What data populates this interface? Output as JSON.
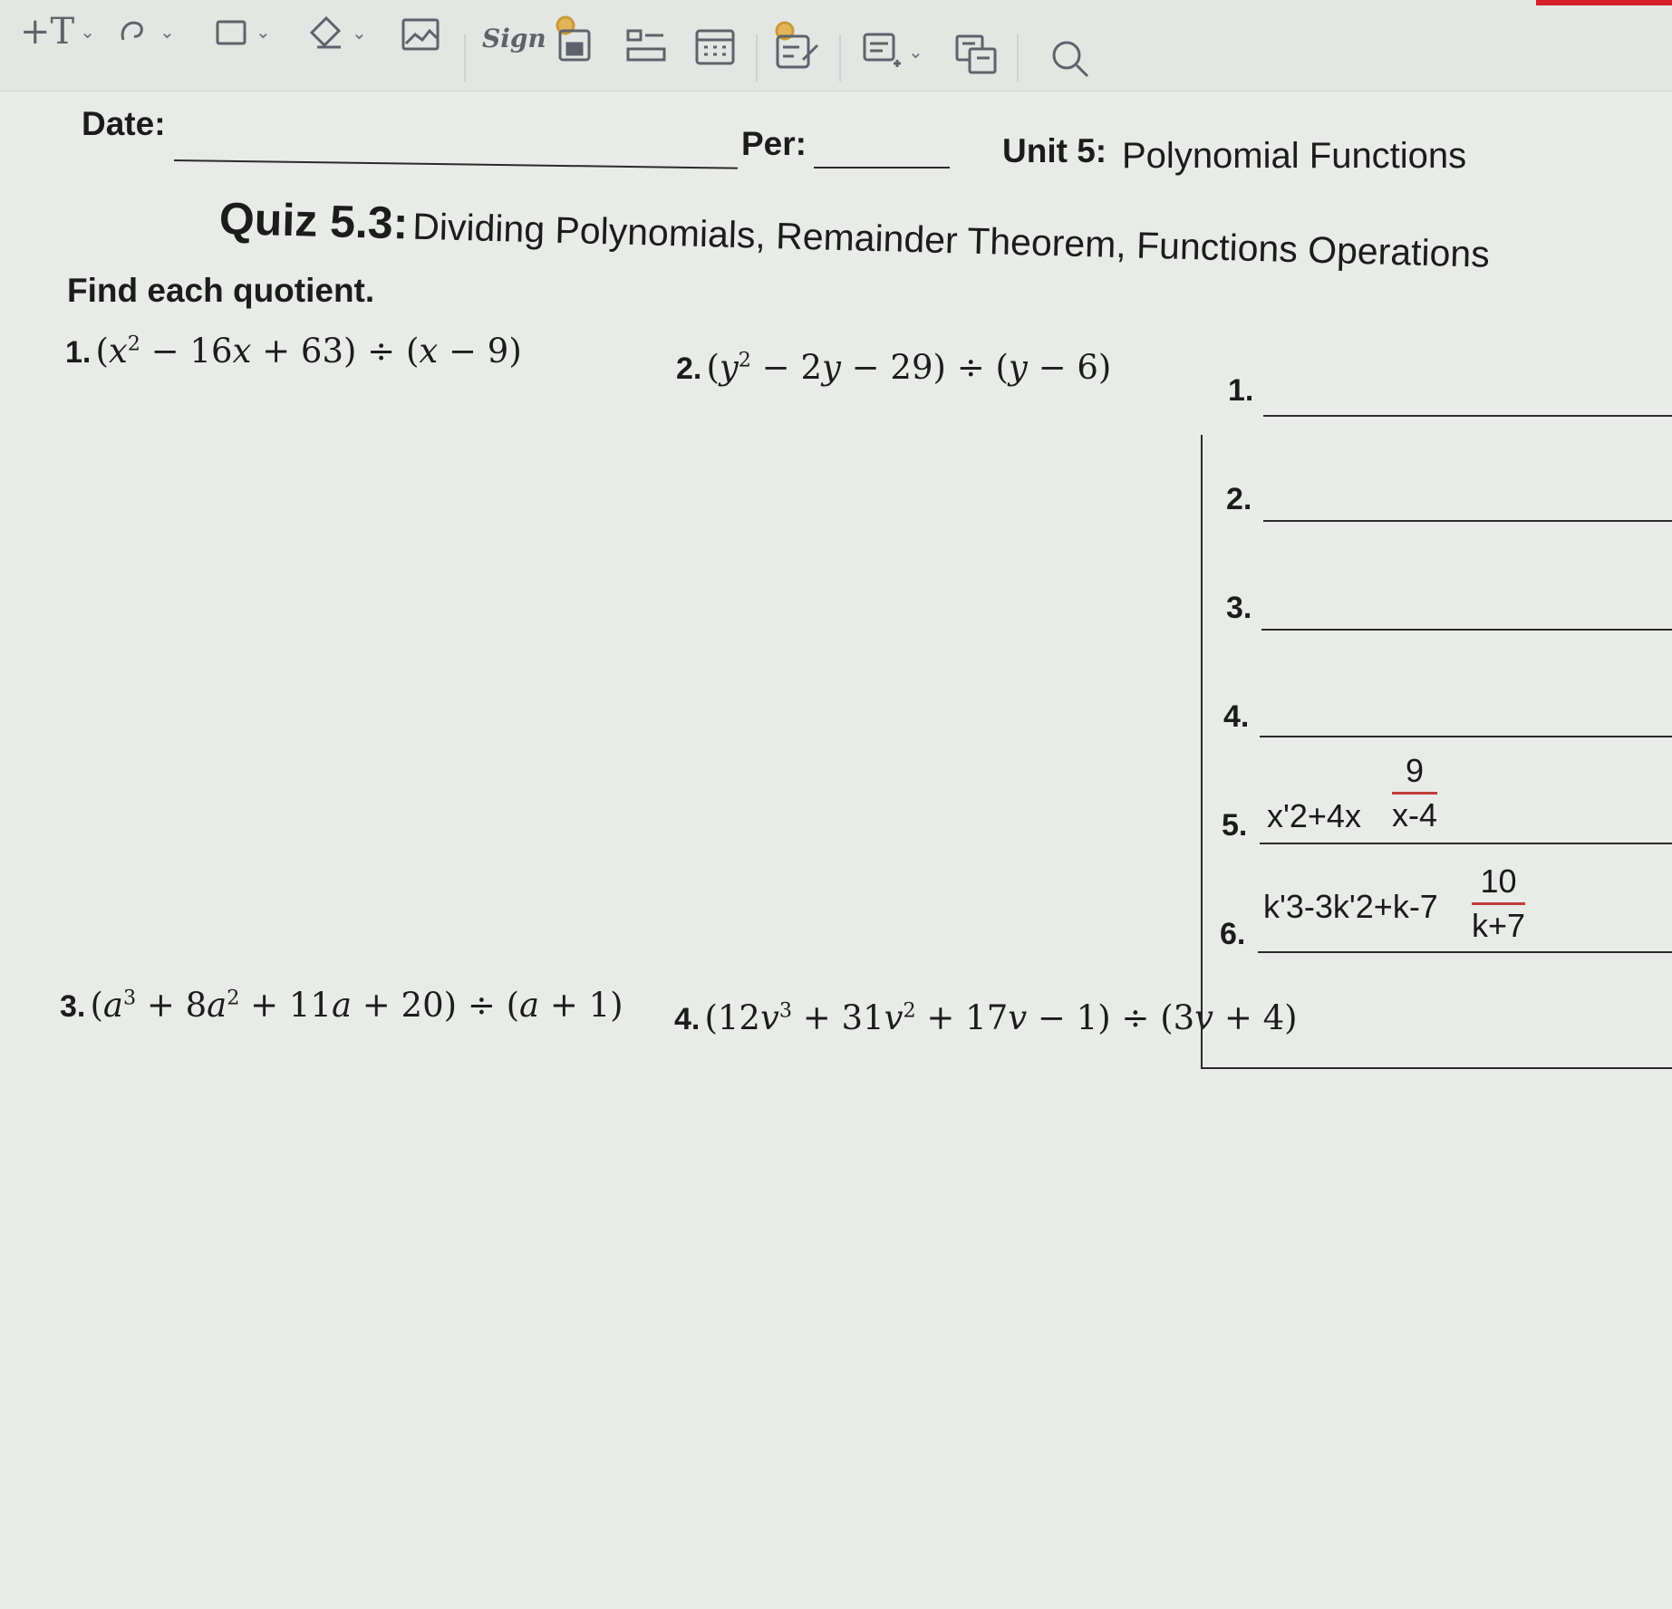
{
  "toolbar": {
    "tools": [
      {
        "icon": "add-text-icon",
        "label": "+T"
      },
      {
        "icon": "draw-icon"
      },
      {
        "icon": "shape-icon"
      },
      {
        "icon": "eraser-icon"
      },
      {
        "icon": "image-icon"
      },
      {
        "icon": "sign-icon",
        "label": "Sign"
      },
      {
        "icon": "stamp-icon"
      },
      {
        "icon": "form-icon"
      },
      {
        "icon": "calendar-icon"
      },
      {
        "icon": "edit-text-icon"
      },
      {
        "icon": "comment-icon"
      },
      {
        "icon": "translate-icon"
      },
      {
        "icon": "search-icon"
      }
    ],
    "accent": "#d81e2c"
  },
  "header": {
    "date_label": "Date:",
    "per_label": "Per:",
    "unit_label": "Unit 5:",
    "unit_title": "Polynomial Functions"
  },
  "quiz": {
    "number": "Quiz 5.3:",
    "title": "Dividing Polynomials, Remainder Theorem, Functions Operations",
    "instruction": "Find each quotient."
  },
  "problems": {
    "p1_num": "1.",
    "p2_num": "2.",
    "p3_num": "3.",
    "p4_num": "4."
  },
  "answers": {
    "labels": [
      "1.",
      "2.",
      "3.",
      "4.",
      "5.",
      "6."
    ],
    "a5_main": "x'2+4x",
    "a5_num": "9",
    "a5_den": "x-4",
    "a6_main": "k'3-3k'2+k-7",
    "a6_num": "10",
    "a6_den": "k+7"
  }
}
